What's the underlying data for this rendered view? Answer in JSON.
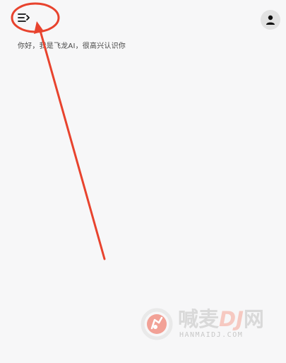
{
  "header": {
    "menu_icon": "menu-expand-icon",
    "avatar_icon": "user-avatar-icon"
  },
  "chat": {
    "greeting": "你好，我是飞龙AI，很高兴认识你"
  },
  "annotation": {
    "color": "#e8432e"
  },
  "watermark": {
    "brand_prefix": "喊麦",
    "brand_dj": "DJ",
    "brand_suffix": "网",
    "url": "HANMAIDJ.COM"
  },
  "colors": {
    "background": "#f7f7f8",
    "accent": "#e8432e"
  }
}
